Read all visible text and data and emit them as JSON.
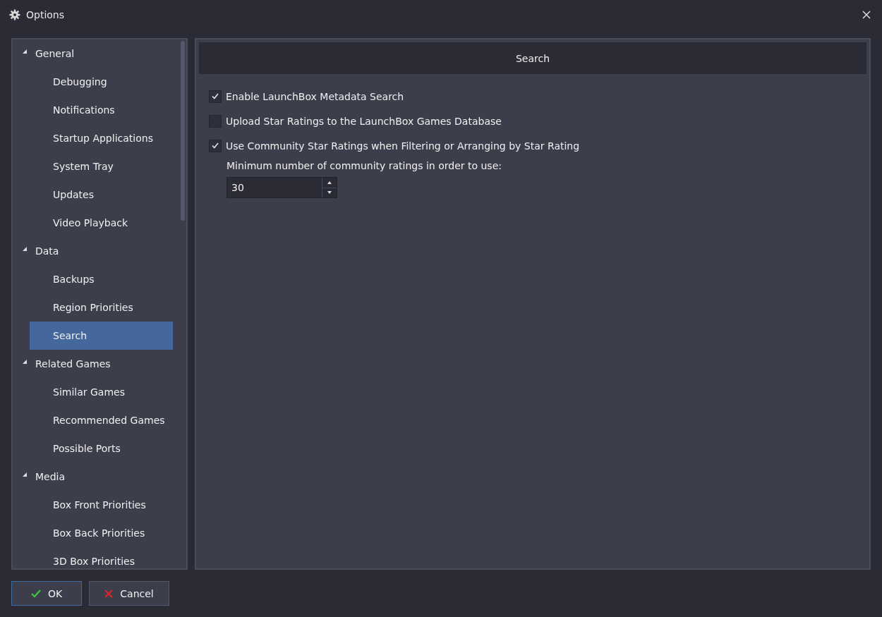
{
  "window": {
    "title": "Options"
  },
  "sidebar": {
    "items": [
      {
        "label": "General",
        "expanded": true,
        "selected": false,
        "children": [
          {
            "label": "Debugging",
            "selected": false
          },
          {
            "label": "Notifications",
            "selected": false
          },
          {
            "label": "Startup Applications",
            "selected": false
          },
          {
            "label": "System Tray",
            "selected": false
          },
          {
            "label": "Updates",
            "selected": false
          },
          {
            "label": "Video Playback",
            "selected": false
          }
        ]
      },
      {
        "label": "Data",
        "expanded": true,
        "selected": false,
        "children": [
          {
            "label": "Backups",
            "selected": false
          },
          {
            "label": "Region Priorities",
            "selected": false
          },
          {
            "label": "Search",
            "selected": true
          }
        ]
      },
      {
        "label": "Related Games",
        "expanded": true,
        "selected": false,
        "children": [
          {
            "label": "Similar Games",
            "selected": false
          },
          {
            "label": "Recommended Games",
            "selected": false
          },
          {
            "label": "Possible Ports",
            "selected": false
          }
        ]
      },
      {
        "label": "Media",
        "expanded": true,
        "selected": false,
        "children": [
          {
            "label": "Box Front Priorities",
            "selected": false
          },
          {
            "label": "Box Back Priorities",
            "selected": false
          },
          {
            "label": "3D Box Priorities",
            "selected": false
          }
        ]
      }
    ]
  },
  "panel": {
    "title": "Search",
    "settings": [
      {
        "kind": "checkbox",
        "label": "Enable LaunchBox Metadata Search",
        "checked": true
      },
      {
        "kind": "checkbox",
        "label": "Upload Star Ratings to the LaunchBox Games Database",
        "checked": false
      },
      {
        "kind": "checkbox",
        "label": "Use Community Star Ratings when Filtering or Arranging by Star Rating",
        "checked": true
      },
      {
        "kind": "number",
        "label": "Minimum number of community ratings in order to use:",
        "value": "30"
      }
    ]
  },
  "buttons": [
    {
      "kind": "ok",
      "label": "OK"
    },
    {
      "kind": "cancel",
      "label": "Cancel"
    }
  ]
}
